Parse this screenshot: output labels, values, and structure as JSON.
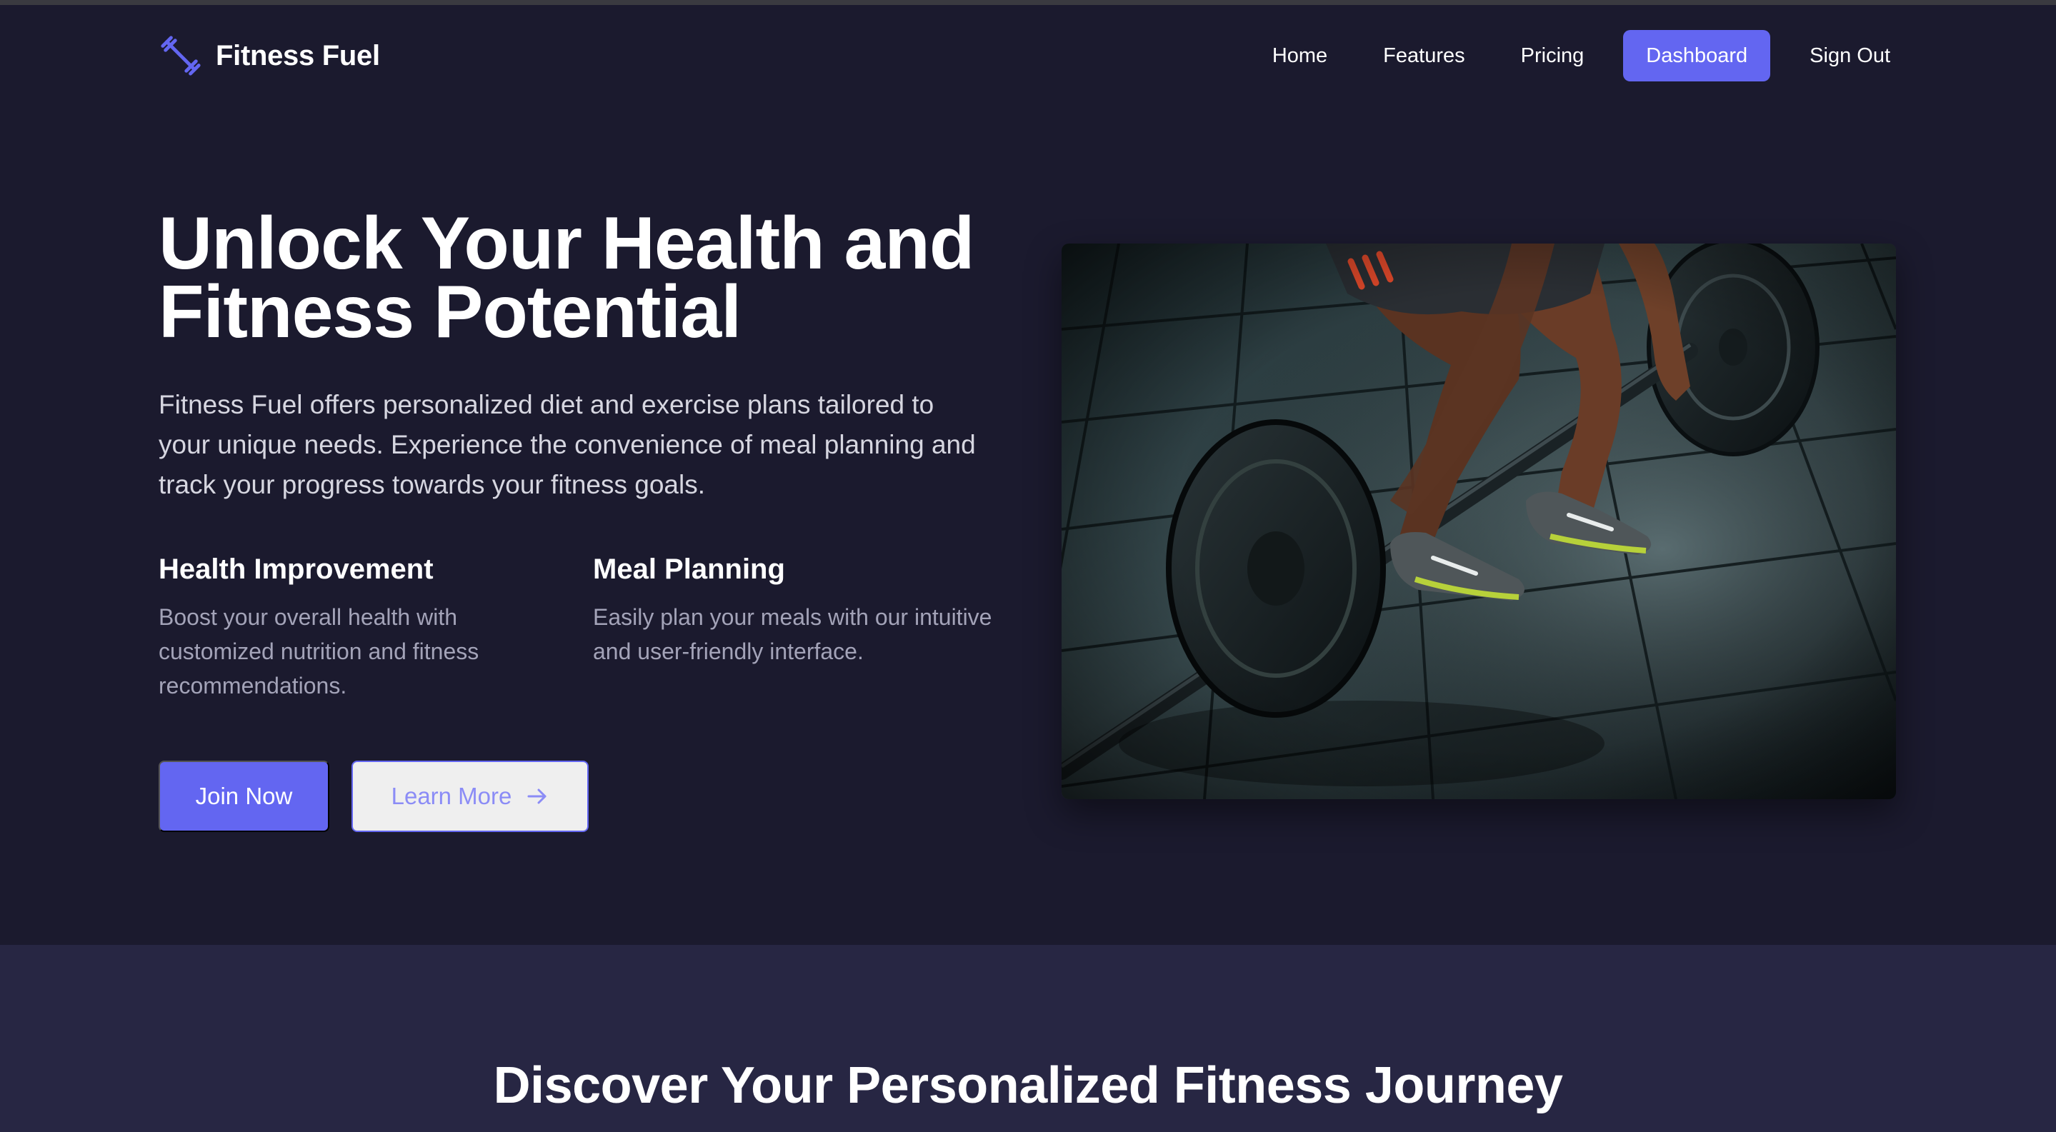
{
  "brand": {
    "name": "Fitness Fuel",
    "icon": "dumbbell-icon",
    "accent": "#6366f1"
  },
  "nav": {
    "items": [
      {
        "label": "Home",
        "active": false
      },
      {
        "label": "Features",
        "active": false
      },
      {
        "label": "Pricing",
        "active": false
      },
      {
        "label": "Dashboard",
        "active": true
      },
      {
        "label": "Sign Out",
        "active": false
      }
    ]
  },
  "hero": {
    "title_line1": "Unlock Your Health and",
    "title_line2": "Fitness Potential",
    "description": "Fitness Fuel offers personalized diet and exercise plans tailored to your unique needs. Experience the convenience of meal planning and track your progress towards your fitness goals.",
    "features": [
      {
        "title": "Health Improvement",
        "text": "Boost your overall health with customized nutrition and fitness recommendations."
      },
      {
        "title": "Meal Planning",
        "text": "Easily plan your meals with our intuitive and user-friendly interface."
      }
    ],
    "primary_button": "Join Now",
    "secondary_button": "Learn More",
    "secondary_button_icon": "arrow-right-icon"
  },
  "section2": {
    "title": "Discover Your Personalized Fitness Journey"
  },
  "colors": {
    "background": "#1b1a2e",
    "section_background": "#272643",
    "accent": "#6366f1",
    "muted_text": "#a3a3b8"
  }
}
